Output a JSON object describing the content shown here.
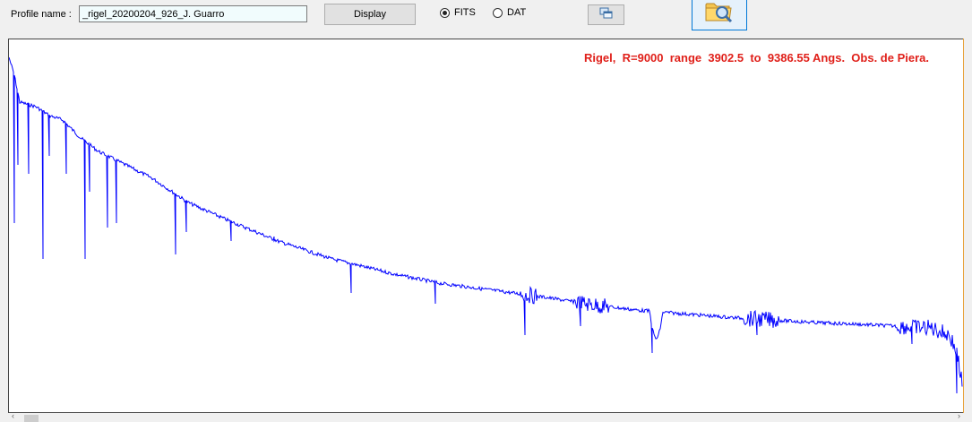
{
  "toolbar": {
    "profile_label": "Profile name :",
    "profile_value": "_rigel_20200204_926_J. Guarro",
    "display_label": "Display",
    "radio_fits_label": "FITS",
    "radio_dat_label": "DAT",
    "selected_format": "FITS",
    "copy_icon": "copy-windows-icon",
    "open_icon": "folder-search-icon"
  },
  "plot": {
    "title": "Rigel,  R=9000  range  3902.5  to  9386.55 Angs.  Obs. de Piera.",
    "line_color": "#0000ff",
    "title_color": "#e0201a"
  },
  "scrollbar": {
    "left_arrow": "‹",
    "right_arrow": "›"
  }
}
